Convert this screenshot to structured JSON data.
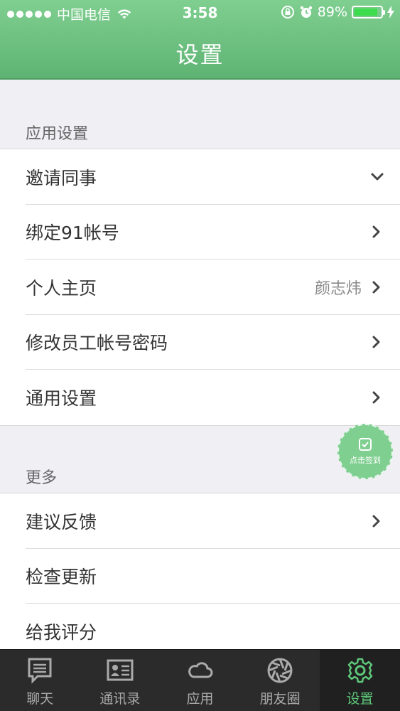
{
  "status_bar": {
    "carrier": "中国电信",
    "time": "3:58",
    "battery": "89%",
    "battery_level": 0.89
  },
  "header": {
    "title": "设置"
  },
  "app_settings": {
    "label": "应用设置",
    "items": [
      {
        "label": "邀请同事",
        "icon": "chevron-down-icon"
      },
      {
        "label": "绑定91帐号",
        "icon": "chevron-right-icon"
      },
      {
        "label": "个人主页",
        "value": "颜志炜",
        "icon": "chevron-right-icon"
      },
      {
        "label": "修改员工帐号密码",
        "icon": "chevron-right-icon"
      },
      {
        "label": "通用设置",
        "icon": "chevron-right-icon"
      }
    ]
  },
  "more": {
    "label": "更多",
    "items": [
      {
        "label": "建议反馈",
        "icon": "chevron-right-icon"
      },
      {
        "label": "检查更新"
      },
      {
        "label": "给我评分"
      }
    ]
  },
  "checkin": {
    "label": "点击签到"
  },
  "tabs": [
    {
      "label": "聊天",
      "icon": "chat-icon"
    },
    {
      "label": "通讯录",
      "icon": "contacts-icon"
    },
    {
      "label": "应用",
      "icon": "cloud-icon"
    },
    {
      "label": "朋友圈",
      "icon": "aperture-icon"
    },
    {
      "label": "设置",
      "icon": "gear-icon",
      "active": true
    }
  ],
  "colors": {
    "header": "#6cc081",
    "accent": "#5ec77a",
    "tabbar": "#2b2b2b"
  }
}
